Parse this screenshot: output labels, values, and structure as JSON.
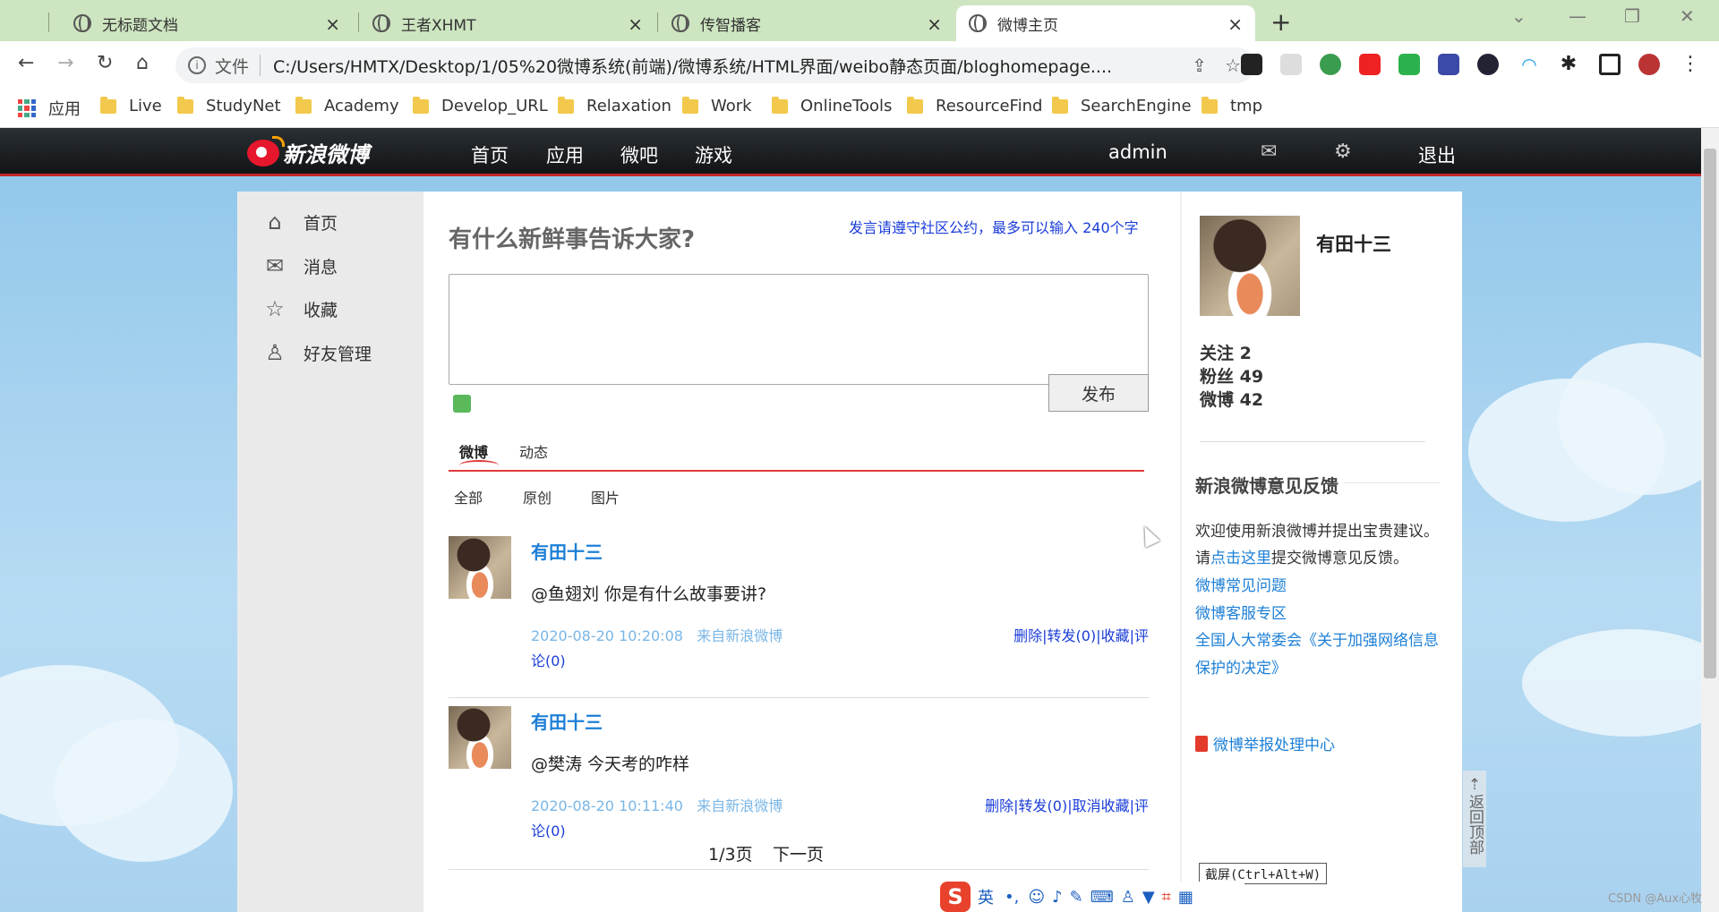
{
  "browser": {
    "tabs": [
      {
        "title": "无标题文档",
        "active": false
      },
      {
        "title": "王者XHMT",
        "active": false
      },
      {
        "title": "传智播客",
        "active": false
      },
      {
        "title": "微博主页",
        "active": true
      }
    ],
    "file_label": "文件",
    "url": "C:/Users/HMTX/Desktop/1/05%20微博系统(前端)/微博系统/HTML界面/weibo静态页面/bloghomepage....",
    "bookmarks": [
      "应用",
      "Live",
      "StudyNet",
      "Academy",
      "Develop_URL",
      "Relaxation",
      "Work",
      "OnlineTools",
      "ResourceFind",
      "SearchEngine",
      "tmp"
    ]
  },
  "topnav": {
    "logo_text": "新浪微博",
    "items": [
      "首页",
      "应用",
      "微吧",
      "游戏"
    ],
    "user": "admin",
    "logout": "退出"
  },
  "leftnav": {
    "items": [
      {
        "label": "首页",
        "icon": "home-icon"
      },
      {
        "label": "消息",
        "icon": "message-icon"
      },
      {
        "label": "收藏",
        "icon": "star-icon"
      },
      {
        "label": "好友管理",
        "icon": "user-icon"
      }
    ]
  },
  "composer": {
    "prompt": "有什么新鲜事告诉大家?",
    "rule": "发言请遵守社区公约，最多可以输入 240个字",
    "publish": "发布"
  },
  "feed_tabs": [
    "微博",
    "动态"
  ],
  "feed_filters": [
    "全部",
    "原创",
    "图片"
  ],
  "posts": [
    {
      "name": "有田十三",
      "text": "@鱼翅刘 你是有什么故事要讲?",
      "time": "2020-08-20 10:20:08",
      "source": "来自新浪微博",
      "actions": "删除|转发(0)|收藏|评",
      "comments": "论(0)"
    },
    {
      "name": "有田十三",
      "text": "@樊涛 今天考的咋样",
      "time": "2020-08-20 10:11:40",
      "source": "来自新浪微博",
      "actions": "删除|转发(0)|取消收藏|评",
      "comments": "论(0)"
    }
  ],
  "pager": {
    "current": "1/3页",
    "next": "下一页"
  },
  "profile": {
    "name": "有田十三",
    "following": "关注 2",
    "fans": "粉丝 49",
    "weibo": "微博 42"
  },
  "feedback": {
    "title": "新浪微博意见反馈",
    "line1": "欢迎使用新浪微博并提出宝贵建议。",
    "line2_pre": "请",
    "line2_link": "点击这里",
    "line2_post": "提交微博意见反馈。",
    "links": [
      "微博常见问题",
      "微博客服专区",
      "全国人大常委会《关于加强网络信息",
      "保护的决定》"
    ],
    "report": "微博举报处理中心"
  },
  "backtop": "返回顶部",
  "ime": {
    "logo": "S",
    "mode": "英"
  },
  "tooltip": "截屏(Ctrl+Alt+W)",
  "watermark": "CSDN @Aux心牧"
}
